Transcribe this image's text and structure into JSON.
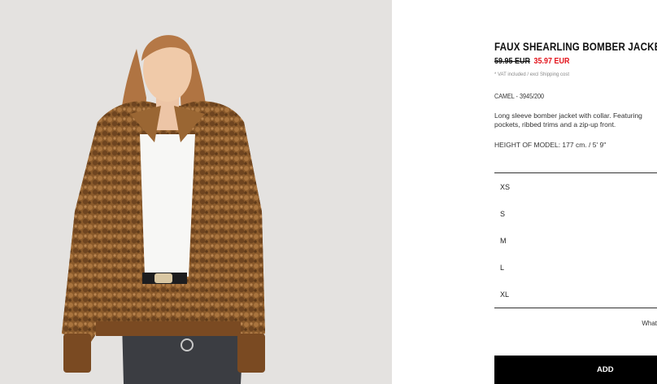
{
  "product": {
    "title": "FAUX SHEARLING BOMBER JACKET",
    "old_price": "59.95 EUR",
    "new_price": "35.97 EUR",
    "vat_note": "* VAT included / excl Shipping cost",
    "color_ref": "CAMEL - 3945/200",
    "description_line1": "Long sleeve bomber jacket with collar. Featuring",
    "description_line2": "pockets, ribbed trims and a zip-up front.",
    "model_height": "HEIGHT OF MODEL: 177 cm. / 5' 9\""
  },
  "sizes": {
    "items": [
      {
        "label": "XS"
      },
      {
        "label": "S"
      },
      {
        "label": "M"
      },
      {
        "label": "L"
      },
      {
        "label": "XL"
      }
    ],
    "guide_label": "What"
  },
  "actions": {
    "add_label": "ADD"
  },
  "colors": {
    "sale": "#e3131b",
    "button": "#000000"
  }
}
